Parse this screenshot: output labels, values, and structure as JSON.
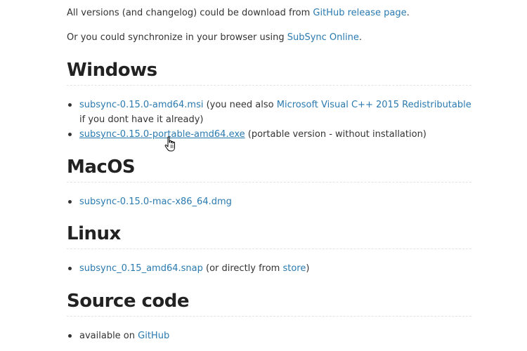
{
  "intro": {
    "line1_text": "All versions (and changelog) could be download from ",
    "line1_link": "GitHub release page",
    "line1_end": ".",
    "line2_text": "Or you could synchronize in your browser using ",
    "line2_link": "SubSync Online",
    "line2_end": "."
  },
  "windows": {
    "heading": "Windows",
    "items": [
      {
        "link": "subsync-0.15.0-amd64.msi",
        "text_before": " (you need also ",
        "link2": "Microsoft Visual C++ 2015 Redistributable",
        "text_after": " if you dont have it already)"
      },
      {
        "link": "subsync-0.15.0-portable-amd64.exe",
        "text": " (portable version - without installation)"
      }
    ]
  },
  "macos": {
    "heading": "MacOS",
    "items": [
      {
        "link": "subsync-0.15.0-mac-x86_64.dmg"
      }
    ]
  },
  "linux": {
    "heading": "Linux",
    "items": [
      {
        "link": "subsync_0.15_amd64.snap",
        "text_before": " (or directly from ",
        "link2": "store",
        "text_after": ")"
      }
    ]
  },
  "source": {
    "heading": "Source code",
    "items": [
      {
        "text": "available on ",
        "link": "GitHub"
      }
    ]
  },
  "colors": {
    "link": "#2a7ab0",
    "text": "#333333",
    "heading": "#222222"
  },
  "icons": {
    "cursor": "hand-pointer-icon"
  }
}
